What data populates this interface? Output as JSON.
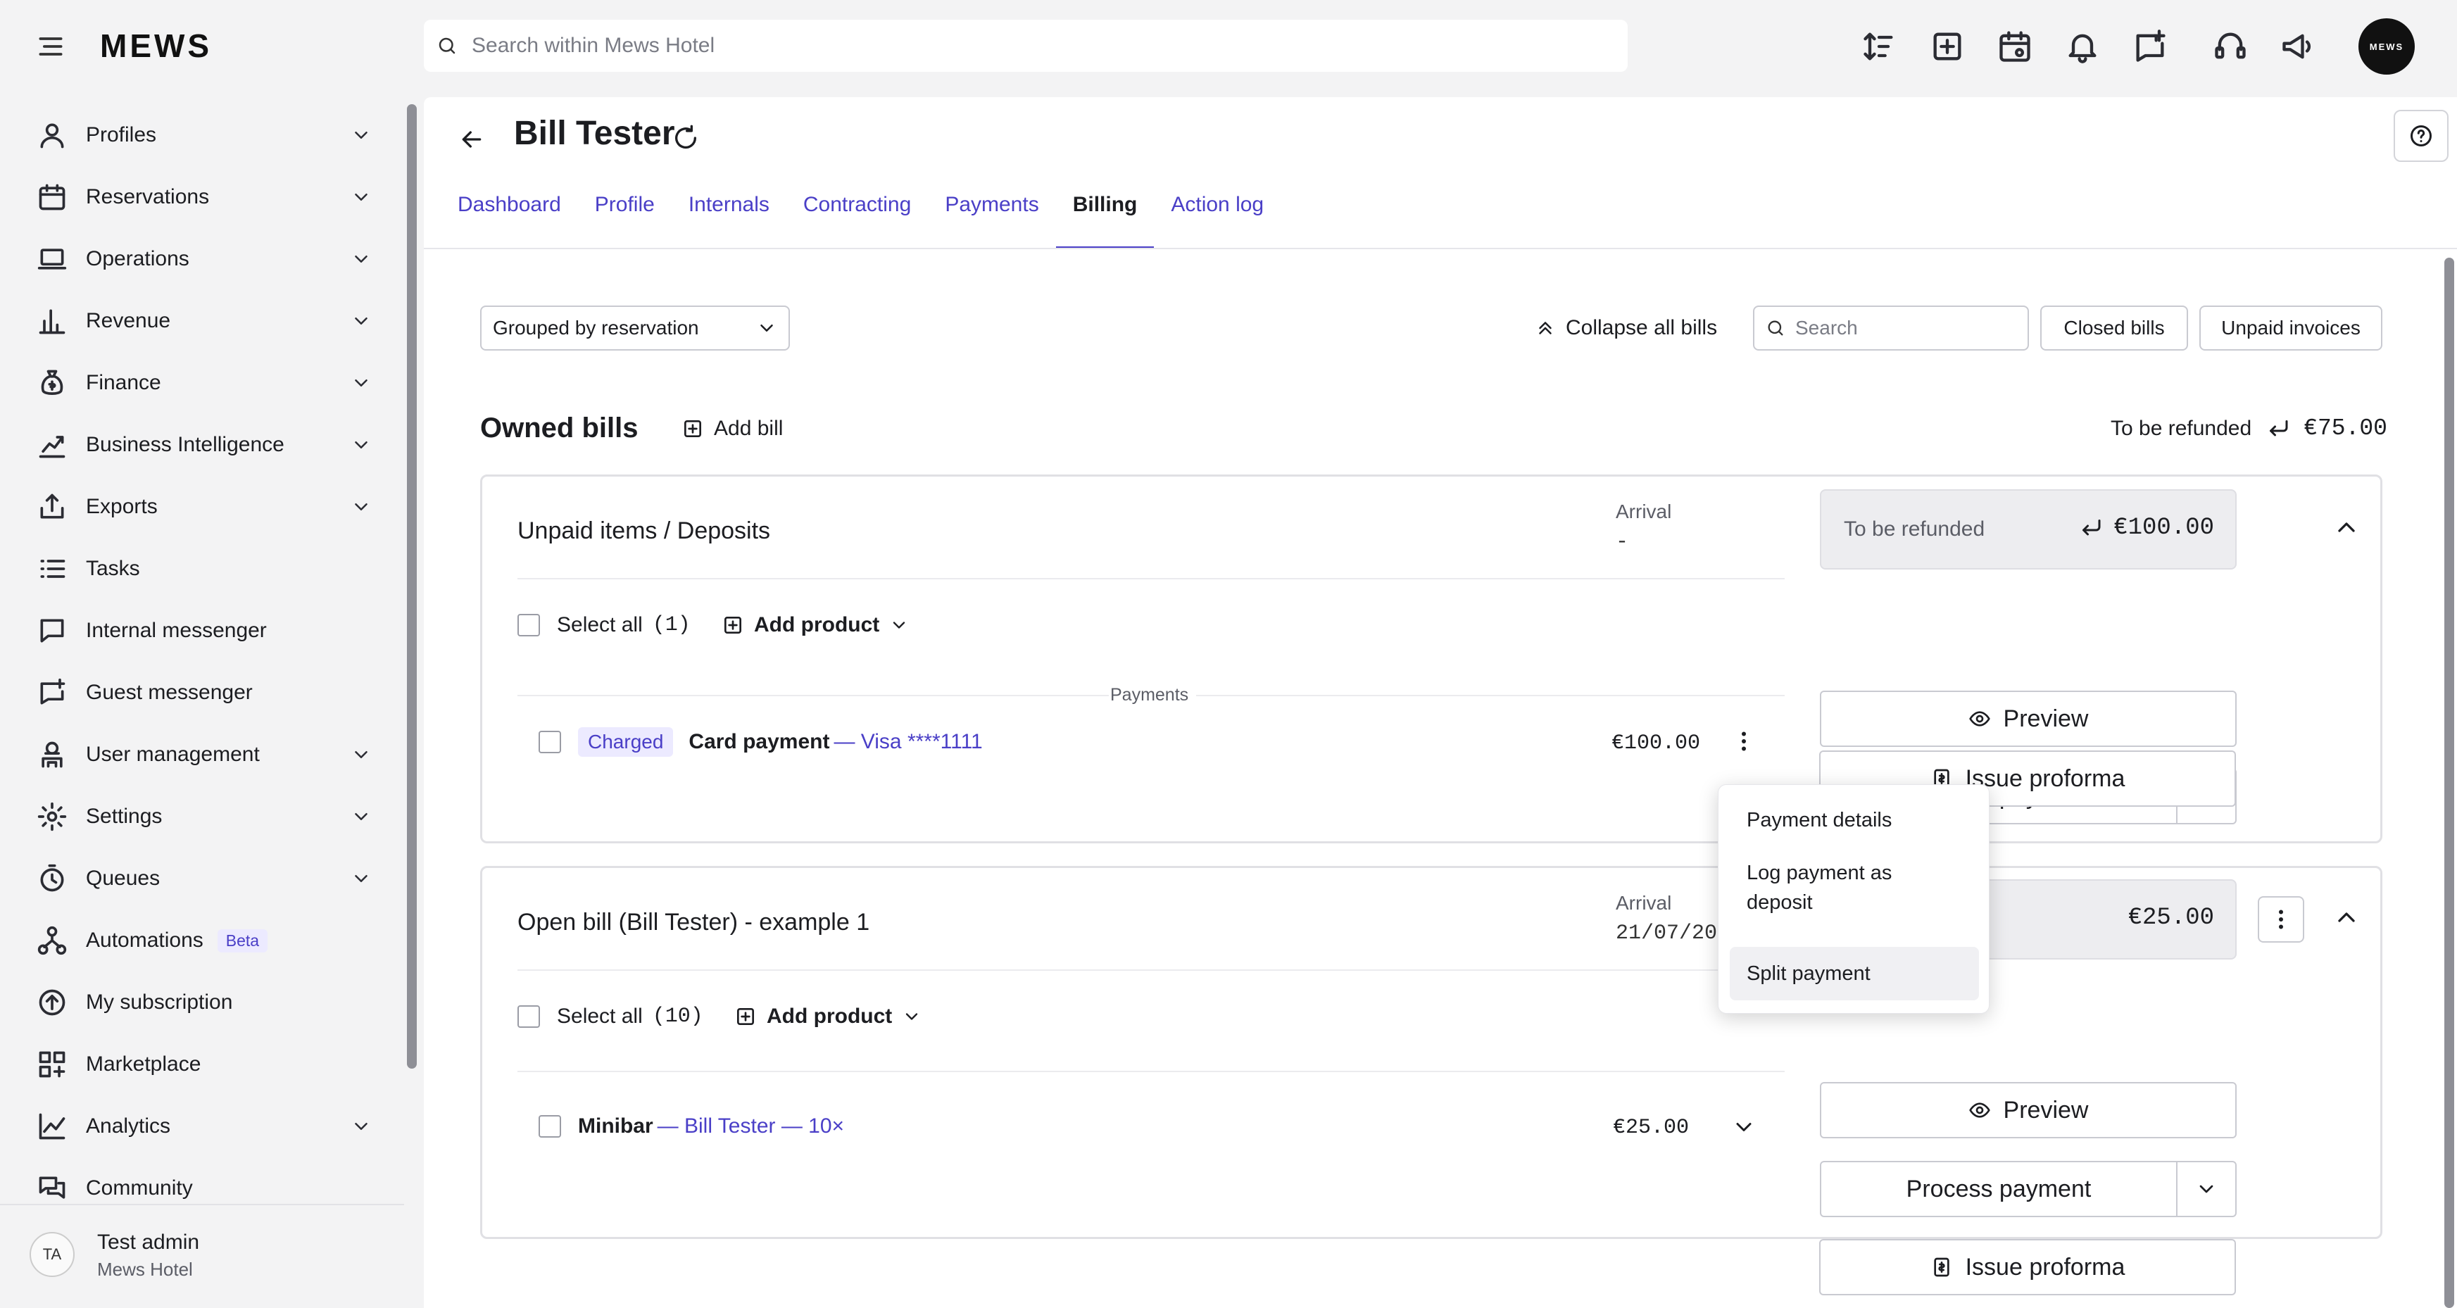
{
  "topbar": {
    "logo": "MEWS",
    "search_placeholder": "Search within Mews Hotel",
    "avatar_text": "MEWS",
    "icons": [
      "sort-icon",
      "add-icon",
      "calendar-icon",
      "bell-icon",
      "messenger-icon",
      "support-icon",
      "announcement-icon"
    ]
  },
  "sidebar": {
    "items": [
      {
        "label": "Profiles",
        "icon": "profile-icon",
        "expandable": true
      },
      {
        "label": "Reservations",
        "icon": "calendar-icon",
        "expandable": true
      },
      {
        "label": "Operations",
        "icon": "laptop-icon",
        "expandable": true
      },
      {
        "label": "Revenue",
        "icon": "bar-chart-icon",
        "expandable": true
      },
      {
        "label": "Finance",
        "icon": "money-bag-icon",
        "expandable": true
      },
      {
        "label": "Business Intelligence",
        "icon": "trend-chart-icon",
        "expandable": true
      },
      {
        "label": "Exports",
        "icon": "export-icon",
        "expandable": true
      },
      {
        "label": "Tasks",
        "icon": "tasks-icon",
        "expandable": false
      },
      {
        "label": "Internal messenger",
        "icon": "chat-icon",
        "expandable": false
      },
      {
        "label": "Guest messenger",
        "icon": "guest-chat-icon",
        "expandable": false
      },
      {
        "label": "User management",
        "icon": "user-management-icon",
        "expandable": true
      },
      {
        "label": "Settings",
        "icon": "gear-icon",
        "expandable": true
      },
      {
        "label": "Queues",
        "icon": "timer-icon",
        "expandable": true
      },
      {
        "label": "Automations",
        "icon": "automation-icon",
        "expandable": false,
        "badge": "Beta"
      },
      {
        "label": "My subscription",
        "icon": "subscription-icon",
        "expandable": false
      },
      {
        "label": "Marketplace",
        "icon": "marketplace-icon",
        "expandable": false
      },
      {
        "label": "Analytics",
        "icon": "analytics-icon",
        "expandable": true
      },
      {
        "label": "Community",
        "icon": "community-icon",
        "expandable": false
      }
    ],
    "user": {
      "initials": "TA",
      "name": "Test admin",
      "hotel": "Mews Hotel"
    }
  },
  "page": {
    "title": "Bill Tester",
    "tabs": [
      "Dashboard",
      "Profile",
      "Internals",
      "Contracting",
      "Payments",
      "Billing",
      "Action log"
    ],
    "active_tab": "Billing"
  },
  "toolbar": {
    "group_select": "Grouped by reservation",
    "collapse_all": "Collapse all bills",
    "search_placeholder": "Search",
    "closed_bills": "Closed bills",
    "unpaid_invoices": "Unpaid invoices"
  },
  "owned": {
    "title": "Owned bills",
    "add_bill": "Add bill",
    "refund_label": "To be refunded",
    "refund_amount": "€75.00"
  },
  "bills": [
    {
      "title": "Unpaid items / Deposits",
      "arrival_label": "Arrival",
      "arrival_value": "-",
      "select_all": "Select all",
      "count": "(1)",
      "add_product": "Add product",
      "section_label": "Payments",
      "item": {
        "badge": "Charged",
        "name": "Card payment",
        "sub": "— Visa ****1111",
        "amount": "€100.00"
      },
      "balance_label": "To be refunded",
      "balance_amount": "€100.00",
      "preview": "Preview",
      "process_payment": "Process payment",
      "issue_proforma": "Issue proforma"
    },
    {
      "title": "Open bill (Bill Tester) - example 1",
      "arrival_label": "Arrival",
      "arrival_value": "21/07/20",
      "select_all": "Select all",
      "count": "(10)",
      "add_product": "Add product",
      "item": {
        "name": "Minibar",
        "sub": "— Bill Tester — 10×",
        "amount": "€25.00"
      },
      "balance_amount": "€25.00",
      "preview": "Preview",
      "process_payment": "Process payment",
      "issue_proforma": "Issue proforma"
    }
  ],
  "menu": {
    "items": [
      "Payment details",
      "Log payment as deposit",
      "Split payment"
    ],
    "highlighted": "Split payment"
  },
  "colors": {
    "accent": "#4a3fc7",
    "background": "#f3f3f4",
    "badge_bg": "#eceaff"
  }
}
